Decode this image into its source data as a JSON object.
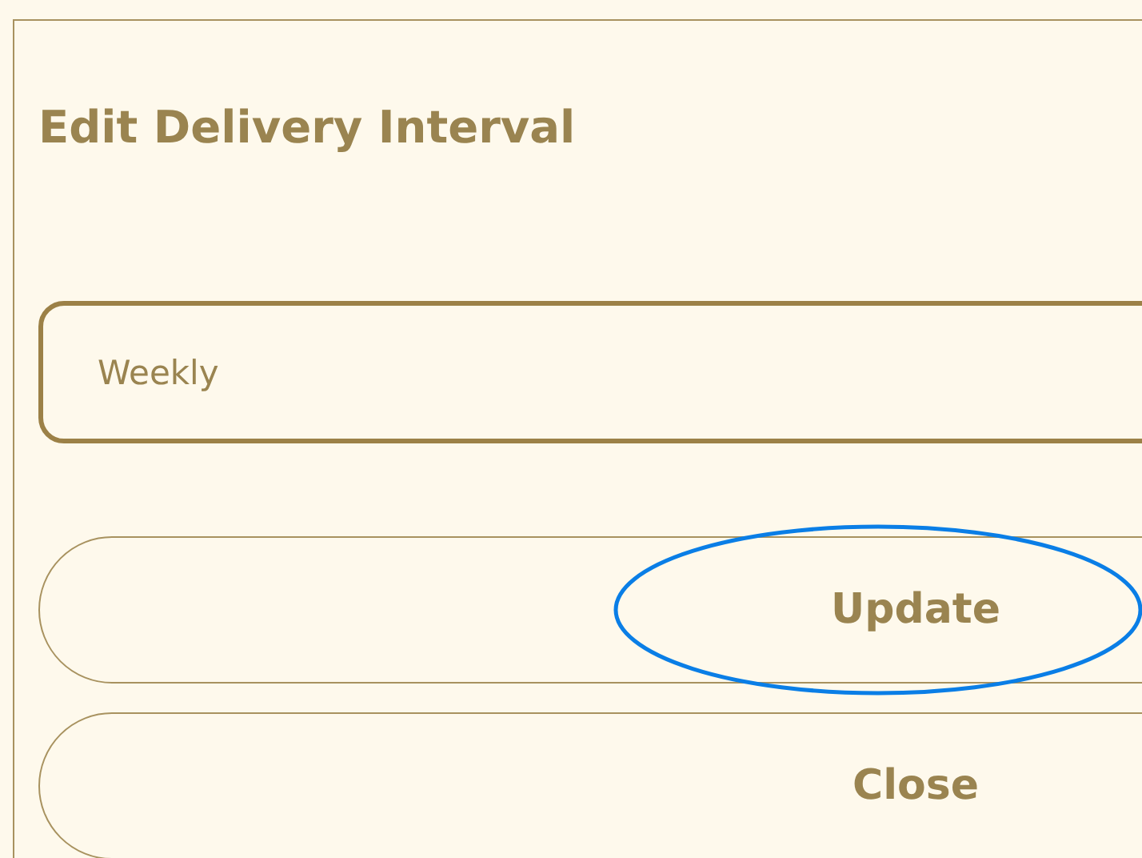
{
  "dialog": {
    "title": "Edit Delivery Interval"
  },
  "interval_field": {
    "value": "Weekly"
  },
  "buttons": [
    {
      "label": "Update",
      "highlighted": true
    },
    {
      "label": "Close",
      "highlighted": false
    }
  ]
}
